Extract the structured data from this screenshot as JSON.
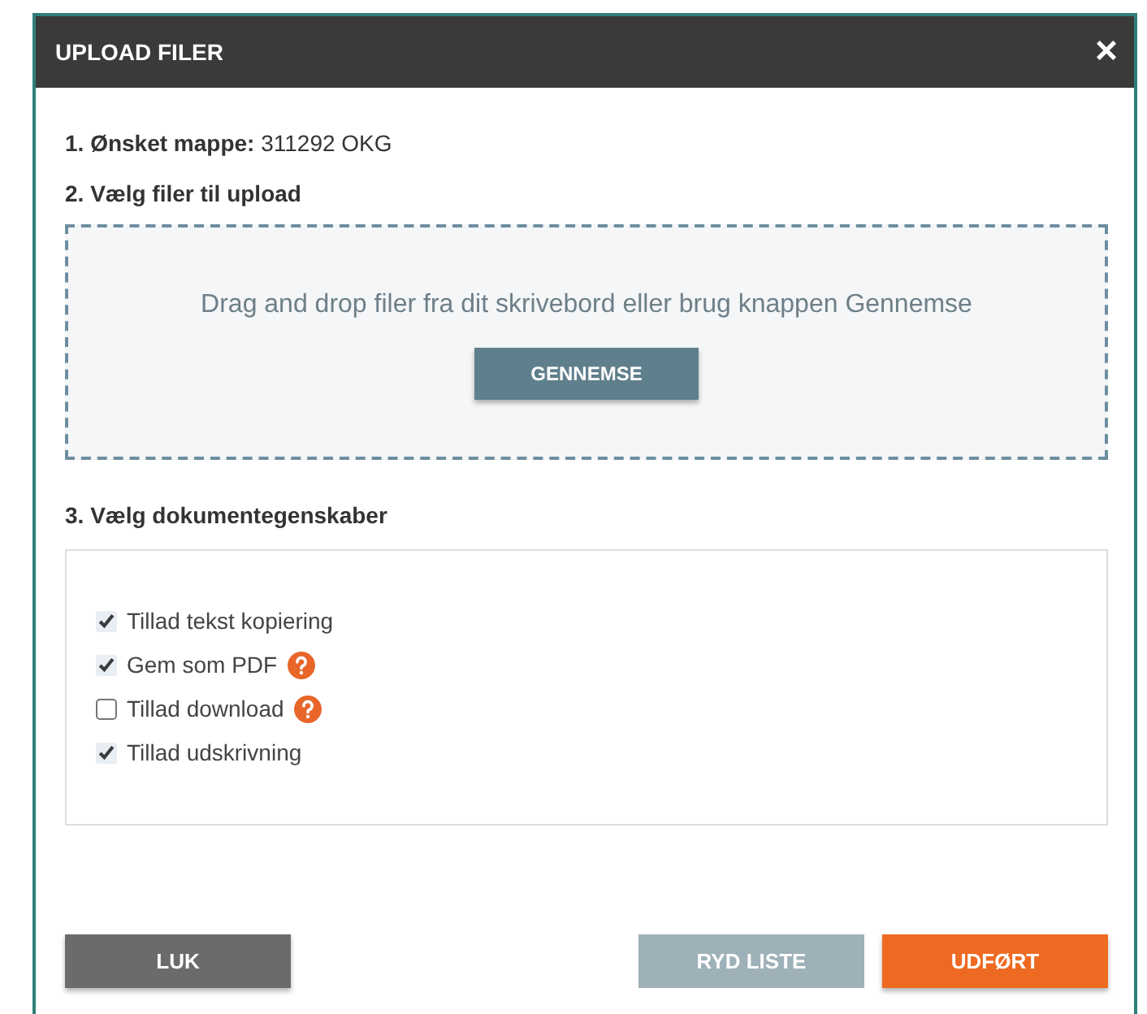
{
  "dialog": {
    "title": "UPLOAD FILER",
    "close": "×"
  },
  "folder": {
    "label": "1. Ønsket mappe:",
    "value": "311292 OKG"
  },
  "files": {
    "label": "2. Vælg filer til upload",
    "hint": "Drag and drop filer fra dit skrivebord eller brug knappen Gennemse",
    "browse": "GENNEMSE"
  },
  "properties": {
    "label": "3. Vælg dokumentegenskaber",
    "options": [
      {
        "label": "Tillad tekst kopiering",
        "checked": true,
        "help": false
      },
      {
        "label": "Gem som PDF",
        "checked": true,
        "help": true
      },
      {
        "label": "Tillad download",
        "checked": false,
        "help": true
      },
      {
        "label": "Tillad udskrivning",
        "checked": true,
        "help": false
      }
    ]
  },
  "buttons": [
    {
      "label": "LUK",
      "kind": "secondary",
      "disabled": false
    },
    {
      "label": "RYD LISTE",
      "kind": "neutral",
      "disabled": true
    },
    {
      "label": "UDFØRT",
      "kind": "primary",
      "disabled": false
    }
  ]
}
